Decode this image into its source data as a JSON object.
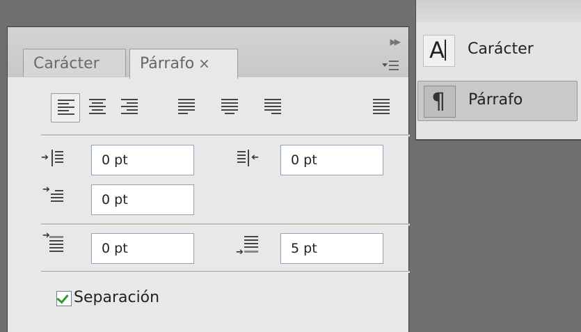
{
  "panel": {
    "tabs": [
      {
        "label": "Carácter"
      },
      {
        "label": "Párrafo",
        "close": "×"
      }
    ],
    "collapse_glyph": "▶▶"
  },
  "alignment": {
    "buttons": [
      {
        "name": "align-left",
        "selected": true
      },
      {
        "name": "align-center",
        "selected": false
      },
      {
        "name": "align-right",
        "selected": false
      },
      {
        "name": "justify-last-left",
        "selected": false
      },
      {
        "name": "justify-last-center",
        "selected": false
      },
      {
        "name": "justify-last-right",
        "selected": false
      },
      {
        "name": "justify-all",
        "selected": false
      }
    ]
  },
  "indents": {
    "left_indent": "0 pt",
    "right_indent": "0 pt",
    "first_line_indent": "0 pt"
  },
  "spacing": {
    "space_before": "0 pt",
    "space_after": "5 pt"
  },
  "hyphenation": {
    "label": "Separación",
    "checked": true
  },
  "dock": {
    "items": [
      {
        "label": "Carácter",
        "icon": "character-icon"
      },
      {
        "label": "Párrafo",
        "icon": "paragraph-icon",
        "active": true
      }
    ]
  },
  "colors": {
    "background": "#6f6f6f",
    "panel": "#e8e8e8",
    "field_border": "#8fa3bd",
    "checkmark": "#2f9a2f"
  }
}
